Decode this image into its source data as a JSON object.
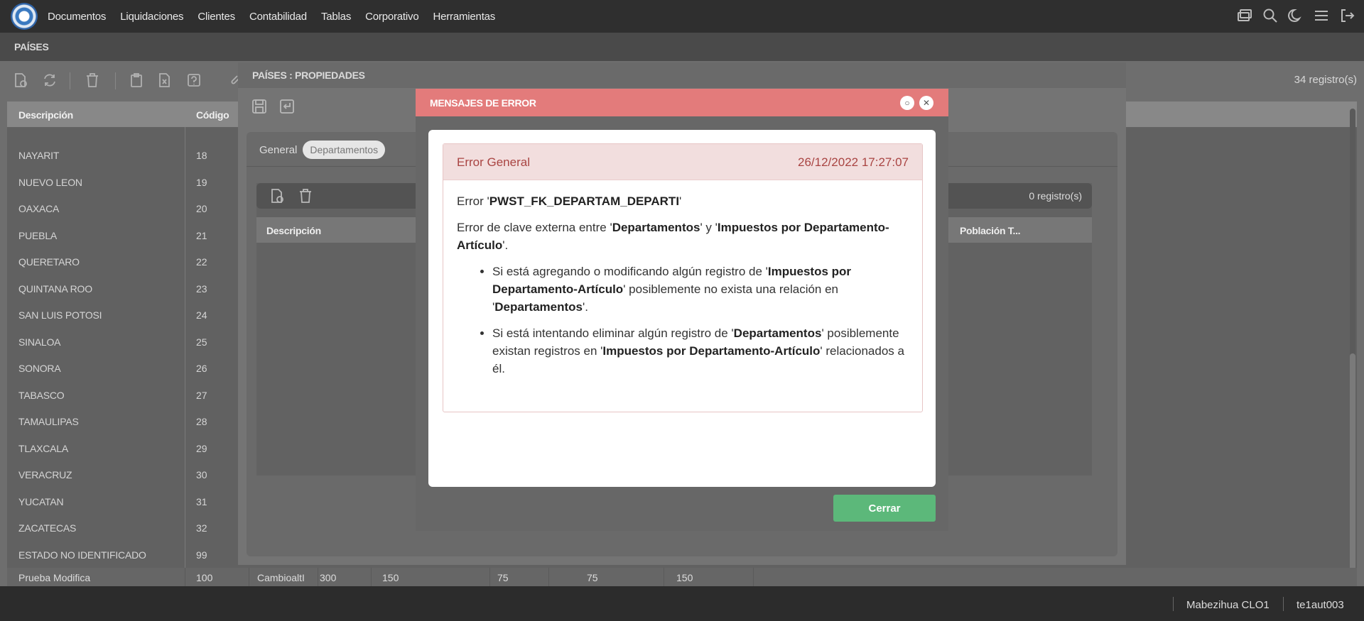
{
  "nav": {
    "items": [
      "Documentos",
      "Liquidaciones",
      "Clientes",
      "Contabilidad",
      "Tablas",
      "Corporativo",
      "Herramientas"
    ]
  },
  "top_icons": [
    "windows-icon",
    "search-icon",
    "moon-icon",
    "menu-icon",
    "logout-icon"
  ],
  "page": {
    "title": "PAÍSES",
    "records": "34 registro(s)"
  },
  "grid": {
    "columns": [
      "Descripción",
      "Código"
    ],
    "rows": [
      {
        "desc": "NAYARIT",
        "code": "18"
      },
      {
        "desc": "NUEVO LEON",
        "code": "19"
      },
      {
        "desc": "OAXACA",
        "code": "20"
      },
      {
        "desc": "PUEBLA",
        "code": "21"
      },
      {
        "desc": "QUERETARO",
        "code": "22"
      },
      {
        "desc": "QUINTANA ROO",
        "code": "23"
      },
      {
        "desc": "SAN LUIS POTOSI",
        "code": "24"
      },
      {
        "desc": "SINALOA",
        "code": "25"
      },
      {
        "desc": "SONORA",
        "code": "26"
      },
      {
        "desc": "TABASCO",
        "code": "27"
      },
      {
        "desc": "TAMAULIPAS",
        "code": "28"
      },
      {
        "desc": "TLAXCALA",
        "code": "29"
      },
      {
        "desc": "VERACRUZ",
        "code": "30"
      },
      {
        "desc": "YUCATAN",
        "code": "31"
      },
      {
        "desc": "ZACATECAS",
        "code": "32"
      },
      {
        "desc": "ESTADO NO IDENTIFICADO",
        "code": "99"
      }
    ],
    "last_row": {
      "desc": "Prueba Modifica",
      "code": "100",
      "c3": "CambioaltI",
      "c4": "300",
      "c5": "150",
      "c6": "75",
      "c7": "75",
      "c8": "150"
    }
  },
  "props": {
    "title": "PAÍSES : PROPIEDADES",
    "tab_general": "General",
    "tab_departments": "Departamentos",
    "sub_records": "0 registro(s)",
    "sub_columns": [
      "Descripción",
      "Población T..."
    ]
  },
  "modal": {
    "title": "MENSAJES DE ERROR",
    "error_title": "Error General",
    "error_date": "26/12/2022 17:27:07",
    "line1_prefix": "Error '",
    "line1_key": "PWST_FK_DEPARTAM_DEPARTI",
    "line1_suffix": "'",
    "line2_a": "Error de clave externa entre '",
    "line2_b": "Departamentos",
    "line2_c": "' y '",
    "line2_d": "Impuestos por Departamento-Artículo",
    "line2_e": "'.",
    "b1_a": "Si está agregando o modificando algún registro de '",
    "b1_b": "Impuestos por Departamento-Artículo",
    "b1_c": "' posiblemente no exista una relación en '",
    "b1_d": "Departamentos",
    "b1_e": "'.",
    "b2_a": "Si está intentando eliminar algún registro de '",
    "b2_b": "Departamentos",
    "b2_c": "' posiblemente existan registros en '",
    "b2_d": "Impuestos por Departamento-Artículo",
    "b2_e": "' relacionados a él.",
    "close_button": "Cerrar"
  },
  "status": {
    "company": "Mabezihua CLO1",
    "user": "te1aut003"
  }
}
